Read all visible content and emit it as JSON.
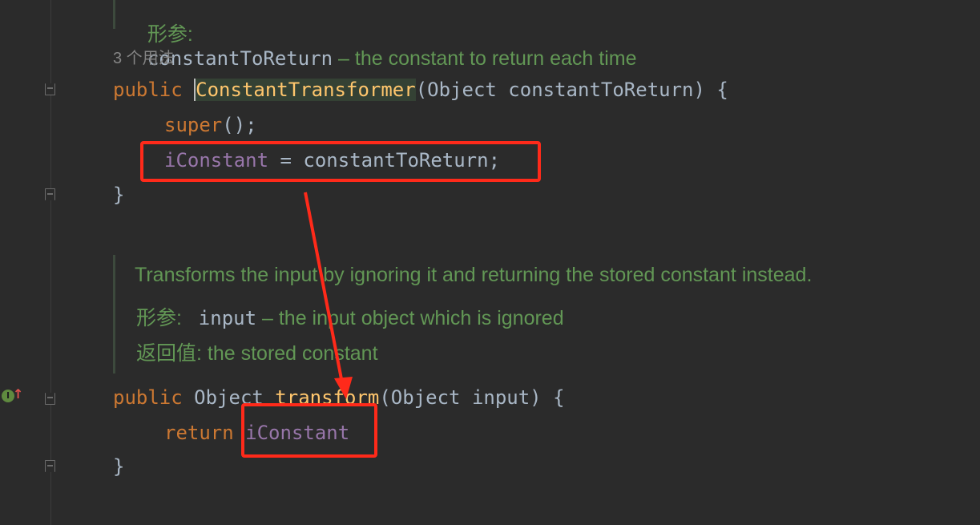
{
  "gutter": {
    "impl_icon_label": "I",
    "impl_arrow": "↑"
  },
  "doc_top": {
    "tag": "形参:",
    "param": "constantToReturn",
    "desc": " – the constant to return each time"
  },
  "usages_hint": "3 个用法",
  "constructor": {
    "kw_public": "public",
    "name": "ConstantTransformer",
    "params": "(Object constantToReturn) {",
    "super_call": "super",
    "super_rest": "();",
    "assign_field": "iConstant",
    "assign_rest": " = constantToReturn;",
    "close": "}"
  },
  "doc_transform": {
    "summary": "Transforms the input by ignoring it and returning the stored constant instead.",
    "param_tag": "形参:",
    "param_name": "input",
    "param_desc": " – the input object which is ignored",
    "return_tag": "返回值:",
    "return_desc": " the stored constant"
  },
  "transform": {
    "kw_public": "public",
    "ret_type": " Object ",
    "name": "transform",
    "params": "(Object input) {",
    "kw_return": "return",
    "field": "iConstant",
    "close": "}"
  },
  "colors": {
    "background": "#2b2b2b",
    "keyword": "#cc7832",
    "method": "#ffc66d",
    "field": "#9876aa",
    "doc": "#629755",
    "annotation_red": "#ff2a1a"
  }
}
